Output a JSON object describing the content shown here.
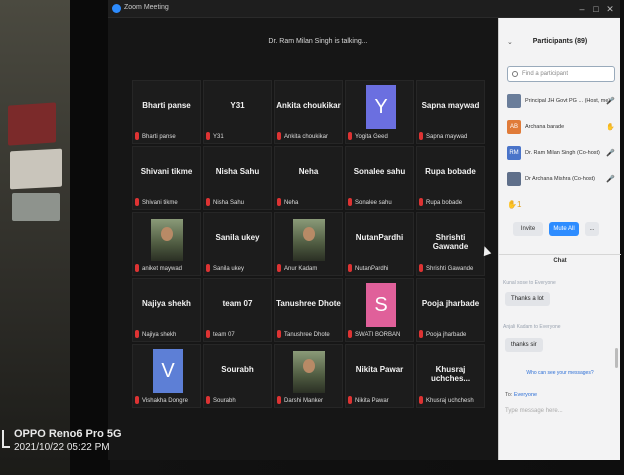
{
  "window": {
    "title": "Zoom Meeting",
    "min": "–",
    "max": "□",
    "close": "✕"
  },
  "talking": "Dr. Ram Milan Singh is talking...",
  "tiles": [
    [
      {
        "big": "Bharti panse",
        "label": "Bharti panse"
      },
      {
        "big": "Y31",
        "label": "Y31"
      },
      {
        "big": "Ankita choukikar",
        "label": "Ankita choukikar"
      },
      {
        "avatar": "Y",
        "avatar_color": "#6b6fe0",
        "label": "Yogita Geed"
      },
      {
        "big": "Sapna maywad",
        "label": "Sapna maywad"
      }
    ],
    [
      {
        "big": "Shivani tikme",
        "label": "Shivani tikme"
      },
      {
        "big": "Nisha Sahu",
        "label": "Nisha Sahu"
      },
      {
        "big": "Neha",
        "label": "Neha"
      },
      {
        "big": "Sonalee sahu",
        "label": "Sonalee sahu"
      },
      {
        "big": "Rupa bobade",
        "label": "Rupa bobade"
      }
    ],
    [
      {
        "photo": true,
        "label": "aniket maywad"
      },
      {
        "big": "Sanila ukey",
        "label": "Sanila ukey"
      },
      {
        "photo": true,
        "label": "Anur Kadam"
      },
      {
        "big": "NutanPardhi",
        "label": "NutanPardhi"
      },
      {
        "big": "Shrishti Gawande",
        "label": "Shrishti Gawande"
      }
    ],
    [
      {
        "big": "Najiya  shekh",
        "label": "Najiya  shekh"
      },
      {
        "big": "team 07",
        "label": "team 07"
      },
      {
        "big": "Tanushree Dhote",
        "label": "Tanushree Dhote"
      },
      {
        "avatar": "S",
        "avatar_color": "#e0609a",
        "label": "SWATI BORBAN"
      },
      {
        "big": "Pooja jharbade",
        "label": "Pooja jharbade"
      }
    ],
    [
      {
        "avatar": "V",
        "avatar_color": "#5d7fd6",
        "label": "Vishakha Dongre"
      },
      {
        "big": "Sourabh",
        "label": "Sourabh"
      },
      {
        "photo": true,
        "label": "Darshi Manker"
      },
      {
        "big": "Nikita Pawar",
        "label": "Nikita Pawar"
      },
      {
        "big": "Khusraj  uchches...",
        "label": "Khusraj uchchesh"
      }
    ]
  ],
  "panel": {
    "title": "Participants (89)",
    "search_placeholder": "Find a participant",
    "participants": [
      {
        "initials": "",
        "name": "Principal JH Govt PG ... (Host, me)",
        "avatar_color": "#6a7d9a"
      },
      {
        "initials": "AB",
        "name": "Archana barade",
        "avatar_color": "#e07b39"
      },
      {
        "initials": "RM",
        "name": "Dr. Ram Milan Singh (Co-host)",
        "avatar_color": "#4a74c9"
      },
      {
        "initials": "",
        "name": "Dr Archana Mishra (Co-host)",
        "avatar_color": "#5f6f8a"
      }
    ],
    "hand_count": "1",
    "invite_label": "Invite",
    "mute_all_label": "Mute All",
    "more_label": "..."
  },
  "chat": {
    "title": "Chat",
    "messages": [
      {
        "from": "Kunal sose to Everyone",
        "text": "Thanks a lot"
      },
      {
        "from": "Anjali Kadam to Everyone",
        "text": "thanks sir"
      }
    ],
    "who_can_see": "Who can see your messages?",
    "to_label": "To:",
    "to_value": "Everyone",
    "placeholder": "Type message here..."
  },
  "photo_stamp": {
    "brand": "OPPO Reno6 Pro 5G",
    "date": "2021/10/22 05:22 PM"
  }
}
